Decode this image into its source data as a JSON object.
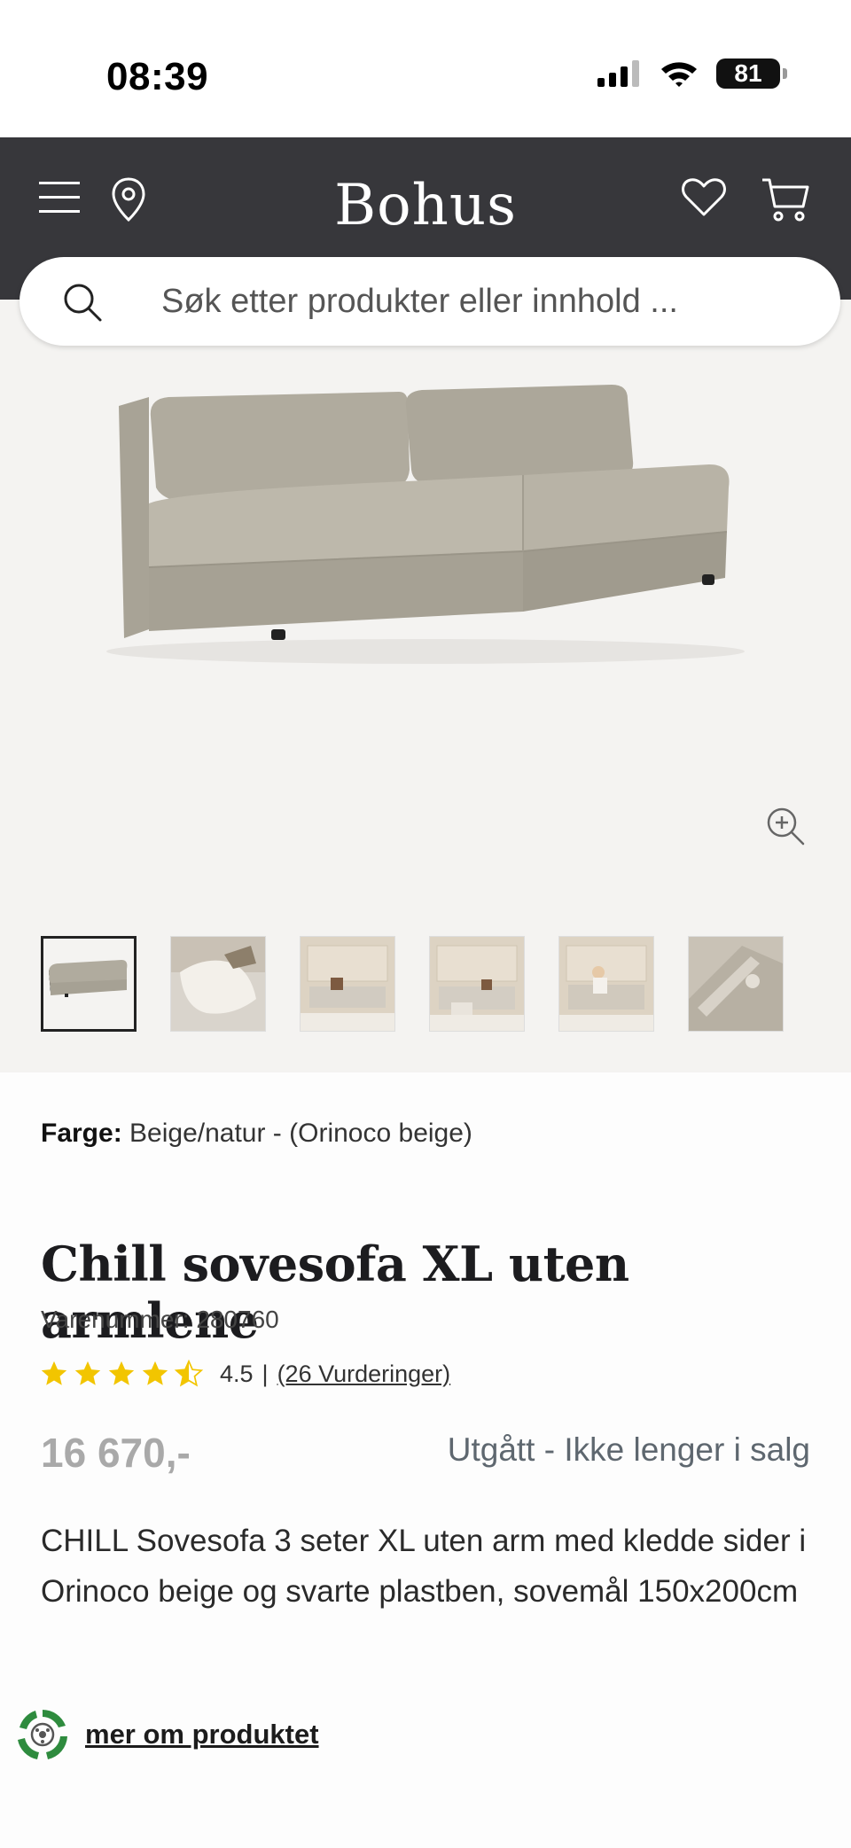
{
  "status_bar": {
    "time": "08:39",
    "battery": "81"
  },
  "header": {
    "logo": "Bohus",
    "icons": [
      "menu-icon",
      "location-pin-icon",
      "heart-icon",
      "cart-icon"
    ]
  },
  "search": {
    "placeholder": "Søk etter produkter eller innhold ..."
  },
  "gallery": {
    "thumbnail_count": 6,
    "active_thumbnail": 1
  },
  "product": {
    "color_label": "Farge:",
    "color_value": "Beige/natur - (Orinoco beige)",
    "title": "Chill sovesofa XL uten armlene",
    "sku_label": "Varenummer: 280760",
    "rating_value": "4.5",
    "rating_separator": "|",
    "reviews_link": "(26 Vurderinger)",
    "rating_stars": 4.5,
    "price": "16 670,-",
    "availability": "Utgått - Ikke lenger i salg",
    "description": "CHILL Sovesofa 3 seter XL uten arm med kledde sider i Orinoco beige og svarte plastben, sovemål 150x200cm",
    "more_link": "mer om produktet"
  },
  "colors": {
    "header_bg": "#37373b",
    "gallery_bg": "#f4f3f1",
    "star": "#f2c500",
    "price_gray": "#a9a9a9",
    "eco_green": "#2e8b3e"
  }
}
